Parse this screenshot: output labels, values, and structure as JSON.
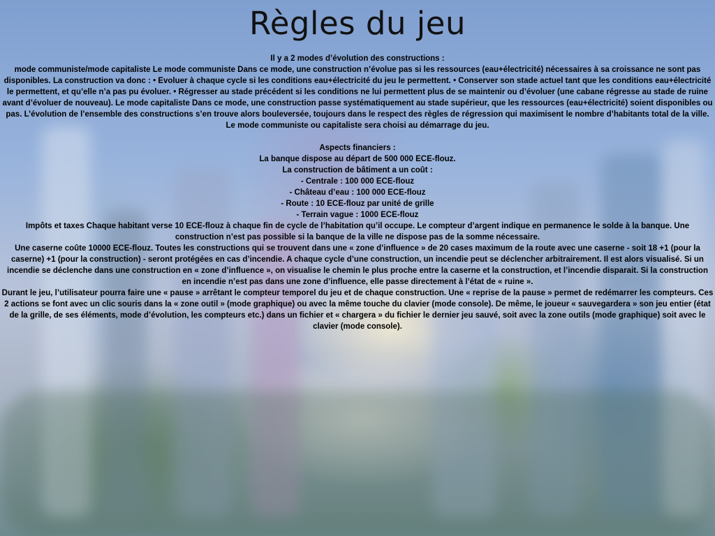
{
  "title": "Règles du jeu",
  "sections": {
    "evolution_heading": "Il y a 2 modes d’évolution des constructions :",
    "evolution_text": "mode communiste/mode capitaliste Le mode communiste Dans ce mode, une construction n’évolue pas si les ressources (eau+électricité) nécessaires à sa croissance ne sont pas disponibles. La construction va donc : • Evoluer à chaque cycle si les conditions eau+électricité du jeu le permettent. • Conserver son stade actuel tant que les conditions eau+électricité le permettent, et qu’elle n’a pas pu évoluer. • Régresser au stade précédent si les conditions ne lui permettent plus de se maintenir ou d’évoluer (une cabane régresse au stade de ruine avant d’évoluer de nouveau). Le mode capitaliste Dans ce mode, une construction passe systématiquement au stade supérieur, que les ressources (eau+électricité) soient disponibles ou pas. L’évolution de l’ensemble des constructions s’en trouve alors bouleversée, toujours dans le respect des règles de régression qui maximisent le nombre d’habitants total de la ville. Le mode communiste ou capitaliste sera choisi au démarrage du jeu.",
    "finance_heading": "Aspects financiers :",
    "bank_line": "La banque dispose au départ de 500 000 ECE-flouz.",
    "cost_heading": "La construction de bâtiment a un coût :",
    "costs": [
      "- Centrale : 100 000 ECE-flouz",
      "- Château d’eau : 100 000 ECE-flouz",
      "- Route : 10 ECE-flouz par unité de grille",
      "- Terrain vague : 1000 ECE-flouz"
    ],
    "taxes_text": "Impôts et taxes Chaque habitant verse 10 ECE-flouz à chaque fin de cycle de l’habitation qu’il occupe. Le compteur d’argent indique en permanence le solde à la banque. Une construction n’est pas possible si la banque de la ville ne dispose pas de la somme nécessaire.",
    "fire_text": "Une caserne coûte 10000 ECE-flouz. Toutes les constructions qui se trouvent dans une « zone d’influence » de 20 cases maximum de la route avec une caserne - soit 18 +1 (pour la caserne) +1 (pour la construction) - seront protégées en cas d’incendie. A chaque cycle d’une construction, un incendie peut se déclencher arbitrairement. Il est alors visualisé. Si un incendie se déclenche dans une construction en « zone d’influence », on visualise le chemin le plus proche entre la caserne et la construction, et l’incendie disparait. Si la construction en incendie n’est pas dans une zone d’influence, elle passe directement à l’état de « ruine ».",
    "pause_text": "Durant le jeu, l’utilisateur pourra faire une « pause » arrêtant le compteur temporel du jeu et de chaque construction. Une « reprise de la pause » permet de redémarrer les compteurs. Ces 2 actions se font avec un clic souris dans la « zone outil » (mode graphique) ou avec la même touche du clavier (mode console). De même, le joueur « sauvegardera » son jeu entier (état de la grille, de ses éléments, mode d’évolution, les compteurs etc.) dans un fichier et « chargera » du fichier le dernier jeu sauvé, soit avec la zone outils (mode graphique) soit avec le clavier (mode console)."
  }
}
